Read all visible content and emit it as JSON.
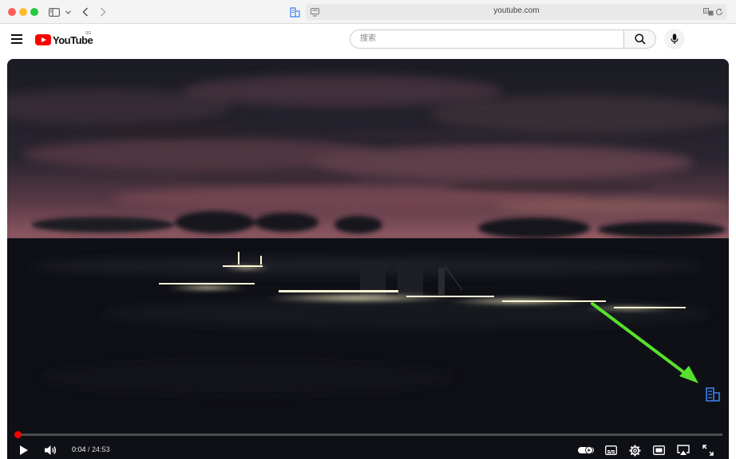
{
  "browser": {
    "url": "youtube.com",
    "icons": [
      "sidebar-icon",
      "chevron-down-icon",
      "back-icon",
      "forward-icon",
      "reader-icon",
      "page-settings-icon",
      "translate-icon",
      "reload-icon"
    ]
  },
  "youtube": {
    "logo_text": "YouTube",
    "region": "SG",
    "search_placeholder": "搜索"
  },
  "player": {
    "current_time": "0:04",
    "separator": " / ",
    "duration": "24:53",
    "progress_fraction": 0.003,
    "icons": [
      "play-icon",
      "volume-icon",
      "autoplay-toggle",
      "subtitles-icon",
      "settings-gear-icon",
      "miniplayer-icon",
      "airplay-icon",
      "fullscreen-icon"
    ]
  },
  "annotation": {
    "arrow_color": "#57e02d",
    "target": "reader-icon"
  },
  "colors": {
    "youtube_red": "#ff0000",
    "safari_blue": "#3b82f6"
  }
}
